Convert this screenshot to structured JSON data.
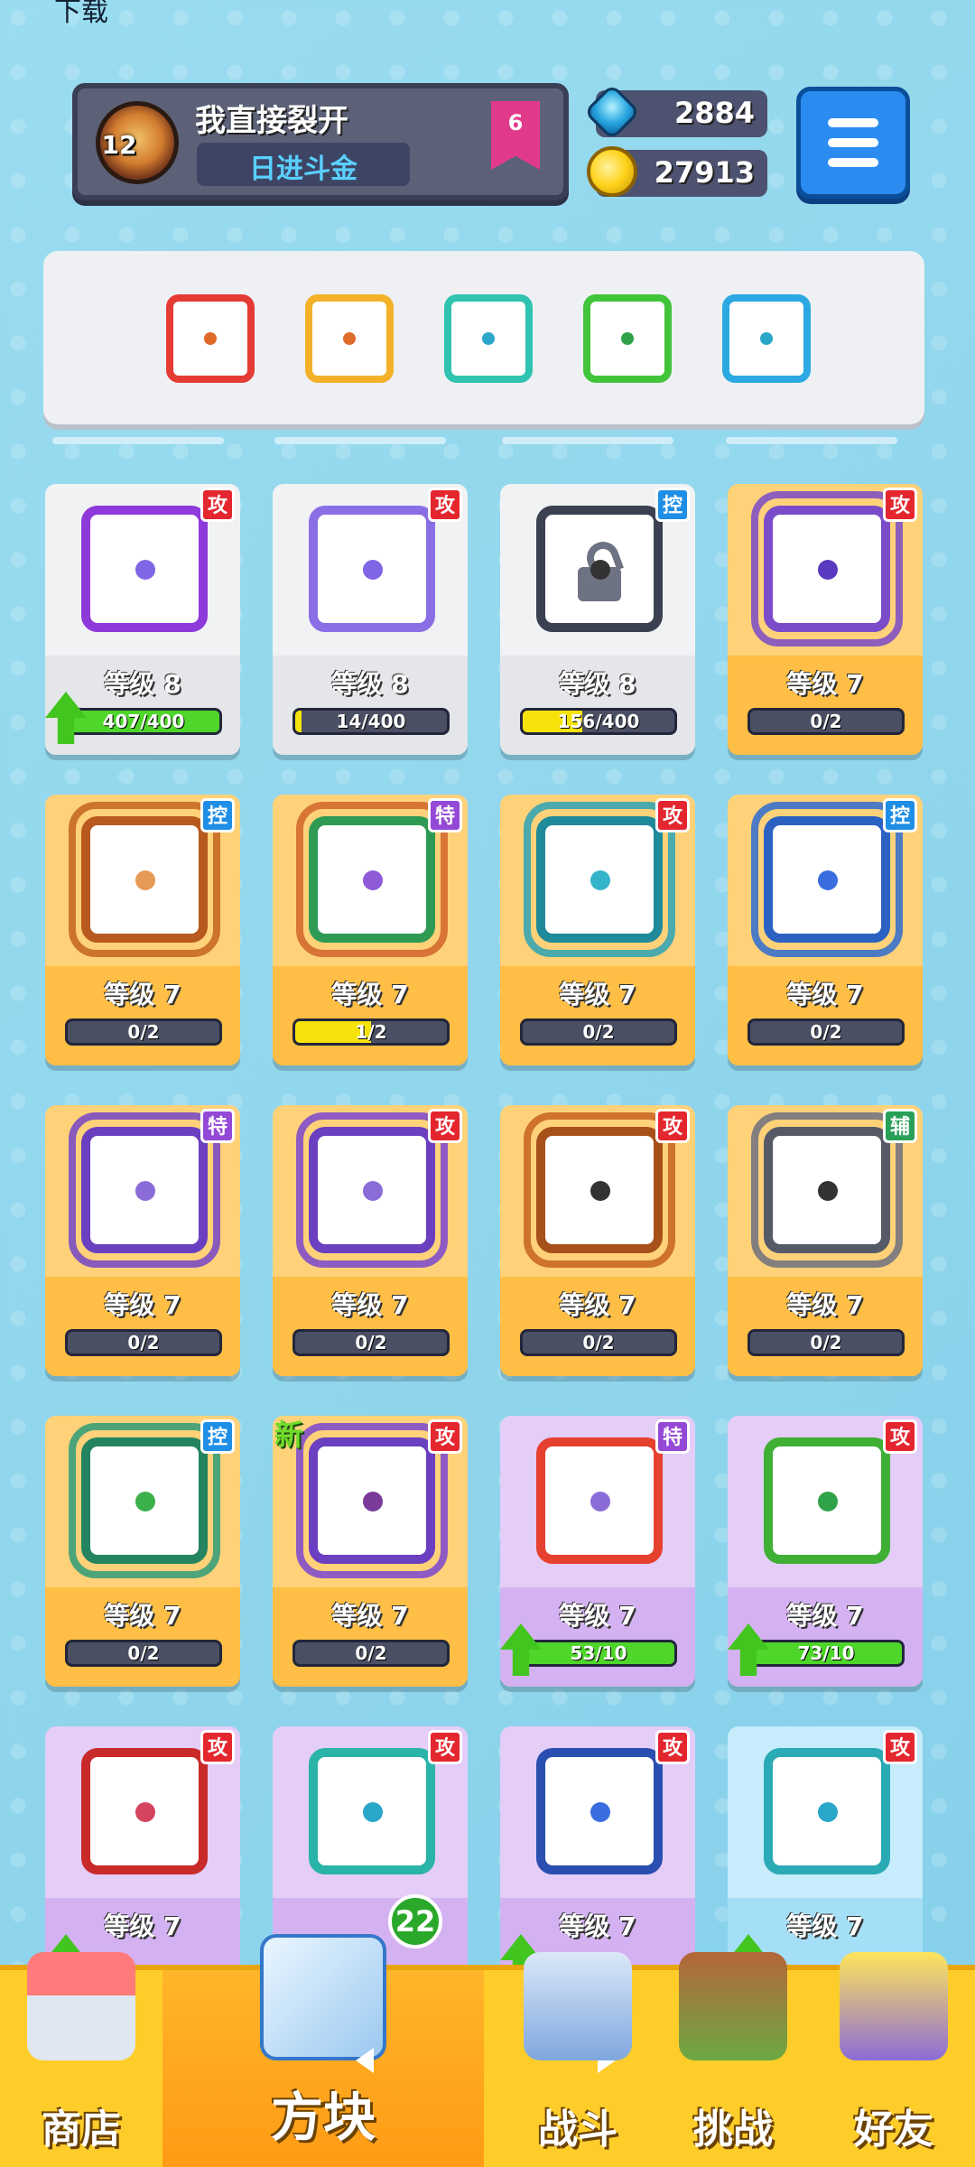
{
  "status_bar": {
    "left": "下载",
    "right": ""
  },
  "profile": {
    "name": "我直接裂开",
    "title": "日进斗金",
    "avatar_level": "12",
    "rank": "6"
  },
  "currency": {
    "gems": "2884",
    "coins": "27913"
  },
  "deck": {
    "slots": [
      {
        "color": "#e53b35",
        "pip": "#e06a2a"
      },
      {
        "color": "#f3b12a",
        "pip": "#e06a2a"
      },
      {
        "color": "#2fc3b0",
        "pip": "#2aa6c9"
      },
      {
        "color": "#42c43a",
        "pip": "#2fa24a"
      },
      {
        "color": "#2ca9e3",
        "pip": "#2aa6c9"
      }
    ]
  },
  "cards": [
    {
      "level": "等级 8",
      "type": "攻",
      "style": "white",
      "border": "#8e39d9",
      "dot": "#8066e6",
      "progress": "407/400",
      "fill": 1.0,
      "fill_color": "green",
      "upgrade": true,
      "frame": ""
    },
    {
      "level": "等级 8",
      "type": "攻",
      "style": "white",
      "border": "#8a6ee6",
      "dot": "#8066e6",
      "progress": "14/400",
      "fill": 0.04,
      "fill_color": "yellow",
      "upgrade": false,
      "frame": ""
    },
    {
      "level": "等级 8",
      "type": "控",
      "style": "white",
      "border": "#3b4150",
      "dot": "#333",
      "progress": "156/400",
      "fill": 0.39,
      "fill_color": "yellow",
      "upgrade": false,
      "frame": "",
      "lock": true
    },
    {
      "level": "等级 7",
      "type": "攻",
      "style": "orange",
      "border": "#7b4cc9",
      "dot": "#5a3ac0",
      "progress": "0/2",
      "fill": 0,
      "fill_color": "yellow",
      "upgrade": false,
      "frame": "#7a4ac8"
    },
    {
      "level": "等级 7",
      "type": "控",
      "style": "orange",
      "border": "#b85a1f",
      "dot": "#e59a55",
      "progress": "0/2",
      "fill": 0,
      "fill_color": "yellow",
      "upgrade": false,
      "frame": "#c4641f"
    },
    {
      "level": "等级 7",
      "type": "特",
      "style": "orange",
      "border": "#2f9a54",
      "dot": "#8e5ad8",
      "progress": "1/2",
      "fill": 0.5,
      "fill_color": "yellow",
      "upgrade": false,
      "frame": "#d0642a"
    },
    {
      "level": "等级 7",
      "type": "攻",
      "style": "orange",
      "border": "#1f8a9a",
      "dot": "#34b4c9",
      "progress": "0/2",
      "fill": 0,
      "fill_color": "yellow",
      "upgrade": false,
      "frame": "#2aa3b5"
    },
    {
      "level": "等级 7",
      "type": "控",
      "style": "orange",
      "border": "#2b62c2",
      "dot": "#3a6ee0",
      "progress": "0/2",
      "fill": 0,
      "fill_color": "yellow",
      "upgrade": false,
      "frame": "#2d6bd0"
    },
    {
      "level": "等级 7",
      "type": "特",
      "style": "orange",
      "border": "#6a3fc0",
      "dot": "#8b6bd8",
      "progress": "0/2",
      "fill": 0,
      "fill_color": "yellow",
      "upgrade": false,
      "frame": "#7444c8"
    },
    {
      "level": "等级 7",
      "type": "攻",
      "style": "orange",
      "border": "#6a3fc0",
      "dot": "#8b6bd8",
      "progress": "0/2",
      "fill": 0,
      "fill_color": "yellow",
      "upgrade": false,
      "frame": "#7a46cf"
    },
    {
      "level": "等级 7",
      "type": "攻",
      "style": "orange",
      "border": "#a8501a",
      "dot": "#333",
      "progress": "0/2",
      "fill": 0,
      "fill_color": "yellow",
      "upgrade": false,
      "frame": "#c6621e"
    },
    {
      "level": "等级 7",
      "type": "辅",
      "style": "orange",
      "border": "#555a66",
      "dot": "#333",
      "progress": "0/2",
      "fill": 0,
      "fill_color": "yellow",
      "upgrade": false,
      "frame": "#6d7180"
    },
    {
      "level": "等级 7",
      "type": "控",
      "style": "orange",
      "border": "#23845f",
      "dot": "#3cb04a",
      "progress": "0/2",
      "fill": 0,
      "fill_color": "yellow",
      "upgrade": false,
      "frame": "#2e9c79"
    },
    {
      "level": "等级 7",
      "type": "攻",
      "style": "orange",
      "border": "#6a3fc0",
      "dot": "#7a3a9a",
      "progress": "0/2",
      "fill": 0,
      "fill_color": "yellow",
      "upgrade": false,
      "frame": "#7a46cf",
      "new": "新"
    },
    {
      "level": "等级 7",
      "type": "特",
      "style": "purple",
      "border": "#e6402f",
      "dot": "#8b6bd8",
      "progress": "53/10",
      "fill": 1.0,
      "fill_color": "green",
      "upgrade": true,
      "frame": ""
    },
    {
      "level": "等级 7",
      "type": "攻",
      "style": "purple",
      "border": "#3faf35",
      "dot": "#2fa24a",
      "progress": "73/10",
      "fill": 1.0,
      "fill_color": "green",
      "upgrade": true,
      "frame": ""
    },
    {
      "level": "等级 7",
      "type": "攻",
      "style": "purple",
      "border": "#c82a2a",
      "dot": "#d4445e",
      "progress": "",
      "fill": 0,
      "fill_color": "green",
      "upgrade": true,
      "frame": ""
    },
    {
      "level": "",
      "type": "攻",
      "style": "purple",
      "border": "#2ab3a8",
      "dot": "#2aa6c9",
      "progress": "",
      "fill": 0,
      "fill_color": "green",
      "upgrade": false,
      "frame": ""
    },
    {
      "level": "等级 7",
      "type": "攻",
      "style": "purple",
      "border": "#2a4fb0",
      "dot": "#3a6ee0",
      "progress": "",
      "fill": 0,
      "fill_color": "green",
      "upgrade": true,
      "frame": ""
    },
    {
      "level": "等级 7",
      "type": "攻",
      "style": "blue",
      "border": "#2aaab5",
      "dot": "#2aa6c9",
      "progress": "",
      "fill": 0,
      "fill_color": "green",
      "upgrade": true,
      "frame": ""
    }
  ],
  "nav": {
    "shop": "商店",
    "dice": "方块",
    "battle": "战斗",
    "challenge": "挑战",
    "friends": "好友",
    "dice_count": "22"
  }
}
